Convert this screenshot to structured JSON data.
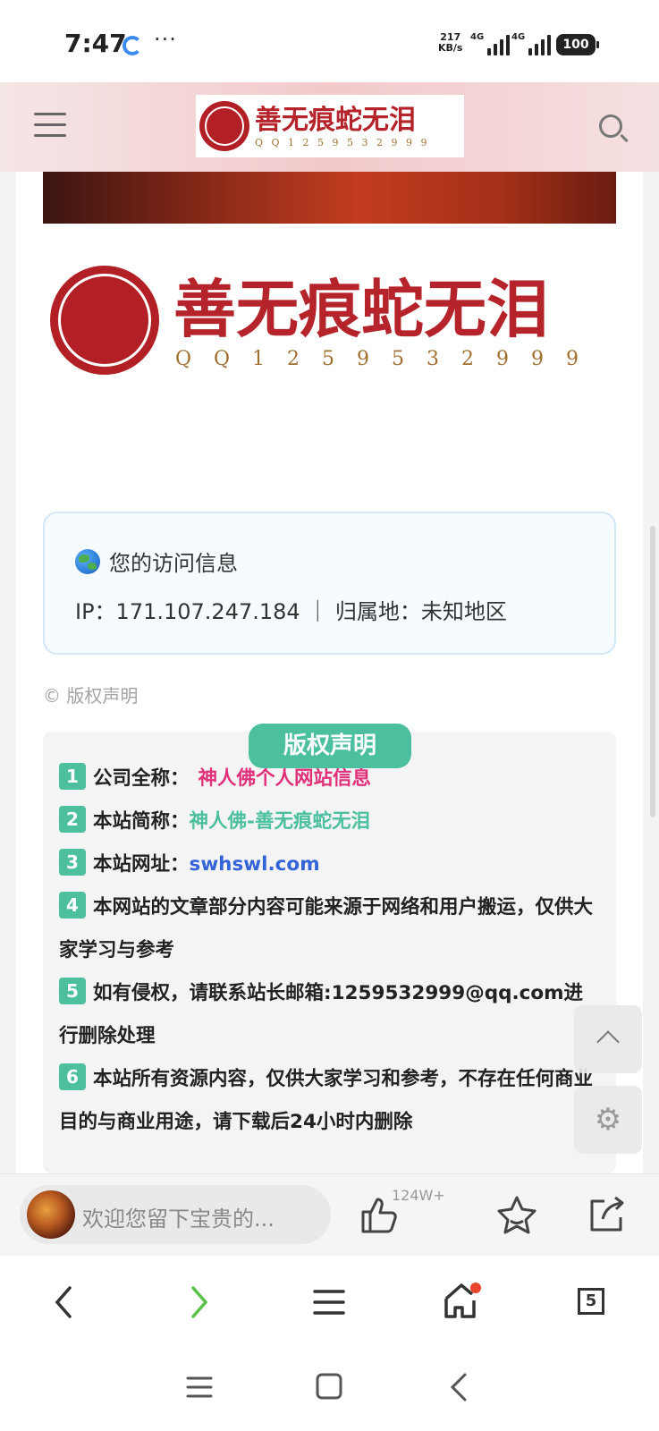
{
  "status_bar": {
    "time": "7:47",
    "more": "···",
    "net_speed_value": "217",
    "net_speed_unit": "KB/s",
    "signal_1_label": "4G",
    "signal_2_label": "4G",
    "battery": "100"
  },
  "header": {
    "logo_title": "善无痕蛇无泪",
    "logo_qq": "Q Q 1 2 5 9 5 3 2 9 9 9"
  },
  "hero_logo": {
    "title": "善无痕蛇无泪",
    "qq": "Q Q 1 2 5 9 5 3 2 9 9 9"
  },
  "visit_info": {
    "title": "您的访问信息",
    "ip_line": "IP：171.107.247.184 ｜ 归属地：未知地区"
  },
  "copyright": {
    "small_label": "© 版权声明",
    "badge": "版权声明",
    "clauses": [
      {
        "num": "1",
        "label": "公司全称：",
        "value": "神人佛个人网站信息"
      },
      {
        "num": "2",
        "label": "本站简称：",
        "value": "神人佛-善无痕蛇无泪"
      },
      {
        "num": "3",
        "label": "本站网址：",
        "value": "swhswl.com"
      },
      {
        "num": "4",
        "text": "本网站的文章部分内容可能来源于网络和用户搬运，仅供大家学习与参考"
      },
      {
        "num": "5",
        "text": "如有侵权，请联系站长邮箱:1259532999@qq.com进行删除处理"
      },
      {
        "num": "6",
        "text": "本站所有资源内容，仅供大家学习和参考，不存在任何商业目的与商业用途，请下载后24小时内删除"
      }
    ]
  },
  "comment_bar": {
    "placeholder": "欢迎您留下宝贵的...",
    "like_count": "124W+"
  },
  "browser_nav": {
    "tabs_count": "5"
  },
  "colors": {
    "brand_red": "#b5232b",
    "accent_green": "#4cbf9f",
    "link_blue": "#3465d8",
    "pink": "#e0307a"
  }
}
